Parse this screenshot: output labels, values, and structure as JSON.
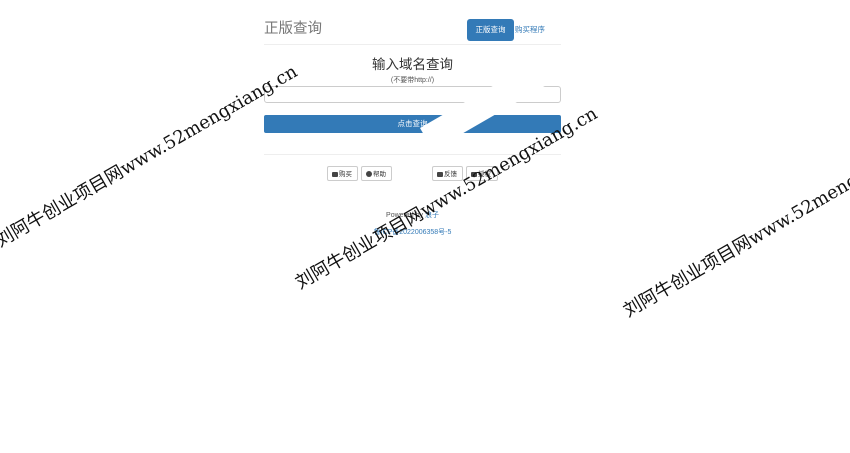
{
  "header": {
    "brand": "正版查询",
    "tab_active": "正版查询",
    "tab_buy": "购买程序"
  },
  "main": {
    "title": "输入域名查询",
    "hint": "(不要带http://)",
    "input_value": "",
    "input_placeholder": "",
    "query_button": "点击查询"
  },
  "toolbar": [
    {
      "label": "购买",
      "icon": "card-icon"
    },
    {
      "label": "帮助",
      "icon": "info-circle-icon"
    },
    {
      "label": "反馈",
      "icon": "card-icon"
    },
    {
      "label": "授权",
      "icon": "card-icon"
    }
  ],
  "footer": {
    "powered_prefix": "Powered by ",
    "powered_name": "浪子",
    "icp": "鲁ICP备2022006358号-5"
  },
  "watermark": "刘阿牛创业项目网www.52mengxiang.cn",
  "colors": {
    "primary": "#337ab7",
    "text": "#333333"
  }
}
